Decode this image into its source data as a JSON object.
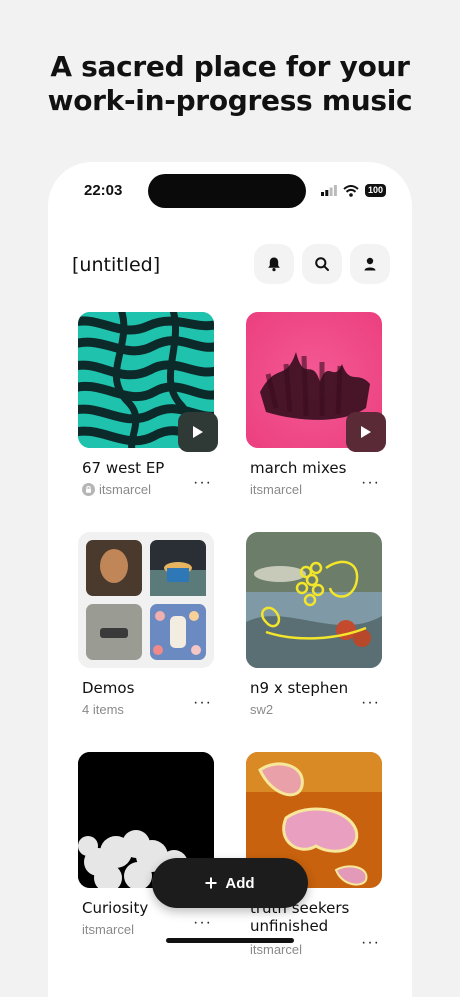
{
  "headline": {
    "line1": "A sacred place for your",
    "line2": "work-in-progress music"
  },
  "status_bar": {
    "time": "22:03",
    "battery": "100",
    "icons": [
      "signal-icon",
      "wifi-icon",
      "battery-icon"
    ]
  },
  "app": {
    "title": "[untitled]",
    "header_icons": [
      "bell-icon",
      "search-icon",
      "profile-icon"
    ]
  },
  "cards": [
    {
      "title": "67 west EP",
      "subtitle": "itsmarcel",
      "lock": true,
      "play": true
    },
    {
      "title": "march mixes",
      "subtitle": "itsmarcel",
      "lock": false,
      "play": true
    },
    {
      "title": "Demos",
      "subtitle": "4 items",
      "lock": false,
      "play": false
    },
    {
      "title": "n9 x stephen",
      "subtitle": "sw2",
      "lock": false,
      "play": false
    },
    {
      "title": "Curiosity",
      "subtitle": "itsmarcel",
      "lock": false,
      "play": false
    },
    {
      "title": "truth seekers unfinished",
      "title_line1": "truth seekers",
      "title_line2": "unfinished",
      "subtitle": "itsmarcel",
      "lock": false,
      "play": false
    }
  ],
  "more_label": "···",
  "add_button": {
    "label": "Add",
    "icon": "plus-icon"
  },
  "colors": {
    "background": "#f2f2f2",
    "card": "#ffffff",
    "dark": "#1c1c1c",
    "muted": "#8a8a8a"
  }
}
